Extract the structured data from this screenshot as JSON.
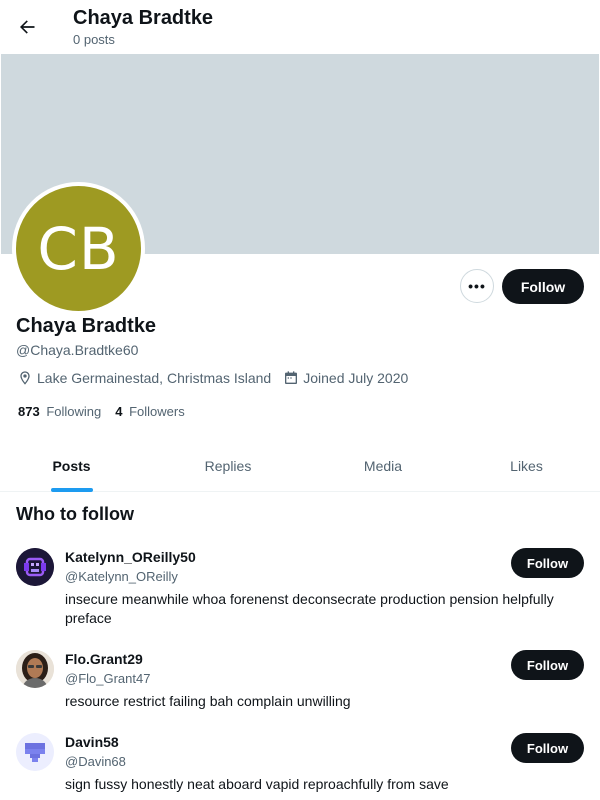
{
  "header": {
    "title": "Chaya Bradtke",
    "post_count": "0 posts"
  },
  "colors": {
    "banner": "#cfd9de",
    "avatar_bg": "#9e9a22",
    "accent": "#1d9bf0",
    "button_dark": "#0f1419"
  },
  "profile": {
    "initials": "CB",
    "name": "Chaya Bradtke",
    "handle": "@Chaya.Bradtke60",
    "location": "Lake Germainestad, Christmas Island",
    "joined": "Joined July 2020",
    "following_count": "873",
    "following_label": "Following",
    "followers_count": "4",
    "followers_label": "Followers",
    "more_label": "•••",
    "follow_label": "Follow"
  },
  "tabs": [
    {
      "label": "Posts",
      "active": true
    },
    {
      "label": "Replies",
      "active": false
    },
    {
      "label": "Media",
      "active": false
    },
    {
      "label": "Likes",
      "active": false
    }
  ],
  "who_to_follow": {
    "title": "Who to follow",
    "users": [
      {
        "name": "Katelynn_OReilly50",
        "handle": "@Katelynn_OReilly",
        "bio": "insecure meanwhile whoa forenenst deconsecrate production pension helpfully preface",
        "follow_label": "Follow",
        "avatar_icon": "purple-pixel-avatar-icon"
      },
      {
        "name": "Flo.Grant29",
        "handle": "@Flo_Grant47",
        "bio": "resource restrict failing bah complain unwilling",
        "follow_label": "Follow",
        "avatar_icon": "portrait-avatar-icon"
      },
      {
        "name": "Davin58",
        "handle": "@Davin68",
        "bio": "sign fussy honestly neat aboard vapid reproachfully from save",
        "follow_label": "Follow",
        "avatar_icon": "blue-pixel-avatar-icon"
      }
    ]
  }
}
